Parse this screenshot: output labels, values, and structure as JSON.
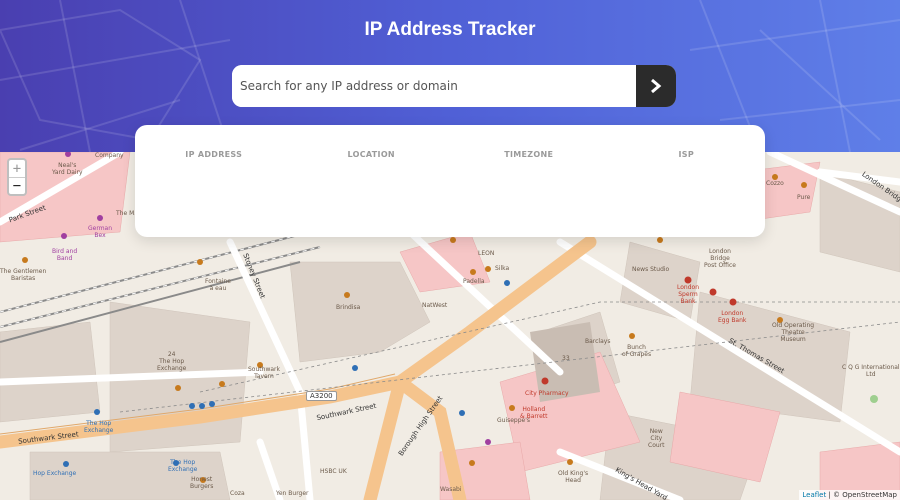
{
  "header": {
    "title": "IP Address Tracker",
    "search_placeholder": "Search for any IP address or domain",
    "search_value": "",
    "submit_icon": "chevron-right-icon"
  },
  "info": {
    "ip_label": "IP ADDRESS",
    "ip_value": "",
    "location_label": "LOCATION",
    "location_value": "",
    "timezone_label": "TIMEZONE",
    "timezone_value": "",
    "isp_label": "ISP",
    "isp_value": ""
  },
  "map": {
    "zoom_in": "+",
    "zoom_out": "−",
    "attribution_leaflet": "Leaflet",
    "attribution_osm": "| © OpenStreetMap",
    "labels": {
      "company": "Company",
      "neals_yard": "Neal's\nYard Dairy",
      "park_street": "Park Street",
      "german_bex": "German\nBex",
      "birdband": "Bird and\nBand",
      "gentlemen": "The Gentlemen\nBaristas",
      "fontaine": "Fontaine\nà eau",
      "stoney_street": "Stoney Street",
      "brindisa": "Brindisa",
      "natwest": "NatWest",
      "padella": "Padella",
      "silka": "Silka",
      "leon": "LEON",
      "news_studio": "News Studio",
      "london_bridge_po": "London\nBridge\nPost Office",
      "sperm_bank": "London\nSperm\nBank",
      "egg_bank": "London\nEgg Bank",
      "old_operating": "Old Operating\nTheatre\nMuseum",
      "london_bridge": "London Bridge",
      "cozzo": "Cozzo",
      "pure": "Pure",
      "barclays": "Barclays",
      "bunch_grapes": "Bunch\nof Grapes",
      "st_thomas": "St. Thomas Street",
      "hop_exchange_24": "24\nThe Hop\nExchange",
      "southwark_tavern": "Southwark\nTavern",
      "a3200": "A3200",
      "southwark_street": "Southwark Street",
      "southwark_street2": "Southwark Street",
      "borough_high": "Borough High Street",
      "city_pharmacy": "City Pharmacy",
      "holland_barrett": "Holland\n& Barrett",
      "guiseppes": "Guiseppe's",
      "new_city_court": "New\nCity\nCourt",
      "kings_head": "King's Head Yard",
      "old_kings_head": "Old King's\nHead",
      "the_hop_exchange": "The Hop\nExchange",
      "hop_exchange2": "The Hop\nExchange",
      "hop_exchange3": "Hop Exchange",
      "hsbc": "HSBC UK",
      "honest_burgers": "Honest\nBurgers",
      "coza": "Coza",
      "yen_burger": "Yen Burger",
      "wasabi": "Wasabi",
      "cqg": "C Q G International\nLtd",
      "num_33": "33",
      "the_mall": "The M..."
    }
  }
}
